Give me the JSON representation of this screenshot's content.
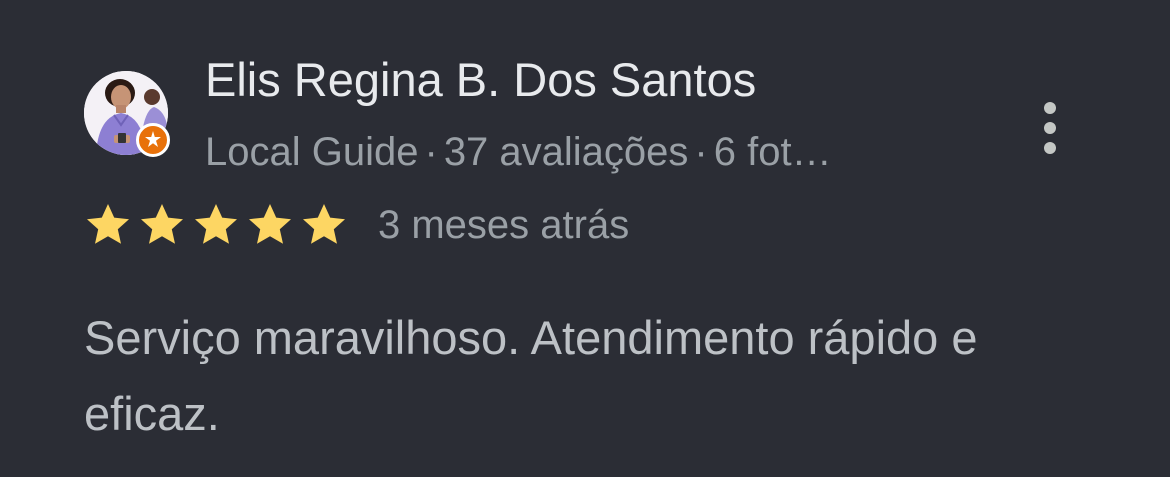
{
  "review": {
    "reviewer_name": "Elis Regina B. Dos Santos",
    "meta": {
      "local_guide": "Local Guide",
      "reviews_count": "37 avaliações",
      "photos_count": "6 fot…",
      "separator": "·"
    },
    "rating": 5,
    "rating_max": 5,
    "date": "3 meses atrás",
    "text": "Serviço maravilhoso. Atendimento rápido e eficaz."
  },
  "icons": {
    "avatar": "avatar-photo",
    "badge": "local-guide-badge-icon",
    "star": "star-icon",
    "more": "more-vert-icon"
  },
  "colors": {
    "background": "#2b2d35",
    "star": "#fdd663",
    "badge": "#e8710a",
    "name_text": "#e8eaed",
    "secondary_text": "#9aa0a6",
    "body_text": "#bdc1c6"
  }
}
